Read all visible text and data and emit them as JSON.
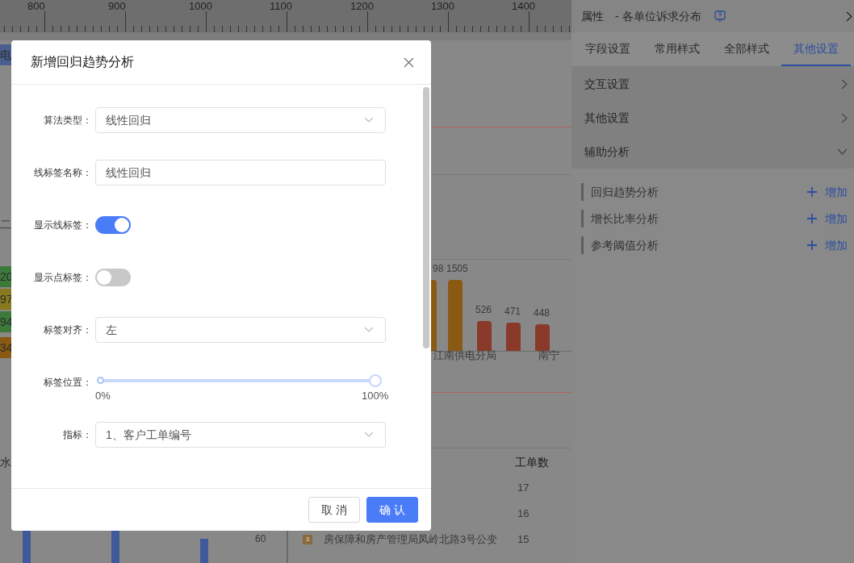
{
  "ruler": {
    "labels": [
      "800",
      "900",
      "1000",
      "1100",
      "1200",
      "1300",
      "1400"
    ]
  },
  "canvas": {
    "left_edge": [
      {
        "text": "电",
        "color": "#4a5f8f"
      },
      {
        "text": "二"
      },
      {
        "text": "20",
        "color": "#3d7a3a"
      },
      {
        "text": "97",
        "color": "#8a7a1f"
      },
      {
        "text": "94",
        "color": "#3d7a3a"
      },
      {
        "text": "34",
        "color": "#8a5a12"
      },
      {
        "text": "水"
      }
    ],
    "bar_labels": [
      {
        "text": "98",
        "color": "#8a5a12"
      },
      {
        "text": "1505",
        "color": "#8a5a12"
      },
      {
        "text": "526",
        "color": "#8a3a2a"
      },
      {
        "text": "471",
        "color": "#8a3a2a"
      },
      {
        "text": "448",
        "color": "#8a3a2a"
      }
    ],
    "axis_labels": [
      "江南供电分局",
      "南宁"
    ],
    "table": {
      "column_header": "工单数",
      "rows": [
        {
          "count": "17"
        },
        {
          "count": "16"
        },
        {
          "rank": "3",
          "name": "房保障和房产管理局凤岭北路3号公变",
          "count": "15"
        }
      ]
    },
    "axis_value": "60"
  },
  "properties_panel": {
    "title": "属性",
    "subtitle": "- 各单位诉求分布",
    "tabs": [
      {
        "label": "字段设置",
        "selected": false
      },
      {
        "label": "常用样式",
        "selected": false
      },
      {
        "label": "全部样式",
        "selected": false
      },
      {
        "label": "其他设置",
        "selected": true
      }
    ],
    "sections": [
      {
        "label": "交互设置",
        "expanded": false
      },
      {
        "label": "其他设置",
        "expanded": false
      },
      {
        "label": "辅助分析",
        "expanded": true
      }
    ],
    "analyses": [
      {
        "label": "回归趋势分析",
        "action": "增加"
      },
      {
        "label": "增长比率分析",
        "action": "增加"
      },
      {
        "label": "参考阈值分析",
        "action": "增加"
      }
    ]
  },
  "dialog": {
    "title": "新增回归趋势分析",
    "fields": [
      {
        "kind": "select",
        "label": "算法类型：",
        "value": "线性回归"
      },
      {
        "kind": "input",
        "label": "线标签名称：",
        "value": "线性回归"
      },
      {
        "kind": "switch",
        "label": "显示线标签：",
        "on": true
      },
      {
        "kind": "switch",
        "label": "显示点标签：",
        "on": false
      },
      {
        "kind": "select",
        "label": "标签对齐：",
        "value": "左"
      },
      {
        "kind": "slider",
        "label": "标签位置：",
        "level": 1,
        "min_label": "0%",
        "max_label": "100%"
      },
      {
        "kind": "select",
        "label": "指标：",
        "value": "1、客户工单编号"
      }
    ],
    "buttons": [
      {
        "label": "取 消",
        "kind": "secondary"
      },
      {
        "label": "确 认",
        "kind": "primary"
      }
    ]
  }
}
